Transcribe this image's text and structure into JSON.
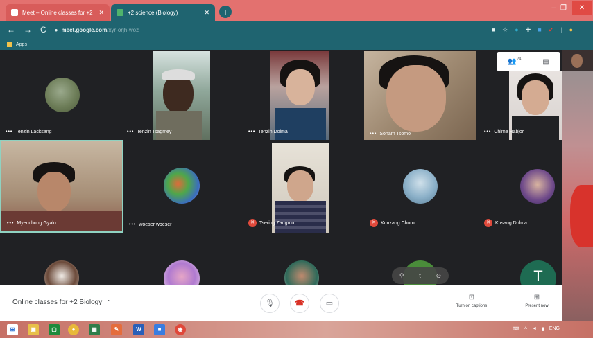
{
  "browser": {
    "tabs": [
      {
        "title": "Meet – Online classes for +2",
        "close": "✕"
      },
      {
        "title": "+2 science (Biology)",
        "close": "✕"
      }
    ],
    "new_tab": "+",
    "url_host": "meet.google.com",
    "url_path": "/xyr-orjh-woz",
    "bookmarks_label": "Apps",
    "nav": {
      "back": "←",
      "forward": "→",
      "reload": "C"
    },
    "window": {
      "minimize": "–",
      "maximize": "❐",
      "close": "✕"
    }
  },
  "meet": {
    "top_controls": {
      "people_count": "24",
      "chat_icon": "chat-icon"
    },
    "participants": [
      {
        "name": "Tenzin Lacksang",
        "muted": false
      },
      {
        "name": "Tenzin Tsagmey",
        "muted": false
      },
      {
        "name": "Tenzin Dolma",
        "muted": false
      },
      {
        "name": "Sonam Tsomo",
        "muted": false
      },
      {
        "name": "Chime Rabjor",
        "muted": false
      },
      {
        "name": "Myenchung Gyalo",
        "muted": false
      },
      {
        "name": "woeser woeser",
        "muted": false
      },
      {
        "name": "Tsering Zangmo",
        "muted": true
      },
      {
        "name": "Kunzang Chorol",
        "muted": true
      },
      {
        "name": "Kusang Dolma",
        "muted": true
      },
      {
        "name": "",
        "muted": false
      },
      {
        "name": "",
        "muted": false
      },
      {
        "name": "",
        "muted": false
      },
      {
        "name": "",
        "muted": false
      },
      {
        "name": "",
        "muted": false
      }
    ],
    "last_tile_initial": "T",
    "bottom": {
      "meeting_title": "Online classes for +2 Biology",
      "captions_label": "Turn on captions",
      "present_label": "Present now"
    },
    "overlay_controls": {
      "pin": "⚲",
      "spotlight": "t",
      "remove": "⊝"
    }
  },
  "taskbar": {
    "tray_lang": "ENG",
    "icons": [
      "windows-start",
      "file-explorer",
      "camtasia",
      "chrome",
      "spreadsheet",
      "paint",
      "word",
      "meet-app",
      "chrome-2"
    ]
  },
  "colors": {
    "chrome_tab_bar": "#e3716f",
    "chrome_toolbar": "#1f6470",
    "meet_bg": "#202124",
    "hangup": "#d93025"
  }
}
